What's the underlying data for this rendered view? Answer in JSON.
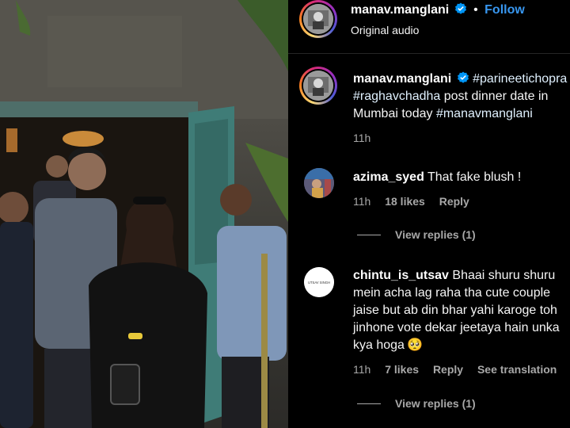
{
  "header": {
    "username": "manav.manglani",
    "follow_label": "Follow",
    "audio_label": "Original audio"
  },
  "caption": {
    "username": "manav.manglani",
    "line1_tag": "#parineetichopra",
    "line2_tag": "#raghavchadha",
    "line2_text": " post dinner date in",
    "line3_text": "Mumbai today ",
    "line3_tag": "#manavmanglani",
    "time": "11h"
  },
  "comments": [
    {
      "username": "azima_syed",
      "text": "That fake blush !",
      "time": "11h",
      "likes": "18 likes",
      "reply_label": "Reply",
      "view_replies": "View replies (1)"
    },
    {
      "username": "chintu_is_utsav",
      "line1": "Bhaai shuru shuru",
      "line2": "mein acha lag raha tha cute couple",
      "line3": "jaise but ab din bhar yahi karoge toh",
      "line4": "jinhone vote dekar jeetaya hain unka",
      "line5": "kya hoga",
      "emoji": "🥺",
      "time": "11h",
      "likes": "7 likes",
      "reply_label": "Reply",
      "translate_label": "See translation",
      "view_replies": "View replies (1)",
      "avatar_text": "UTSAV SINGH"
    }
  ],
  "icons": {
    "verified": "verified-badge-icon",
    "colors": {
      "verified": "#0095f6",
      "link": "#3897f0",
      "muted": "#a8a8a8"
    }
  }
}
